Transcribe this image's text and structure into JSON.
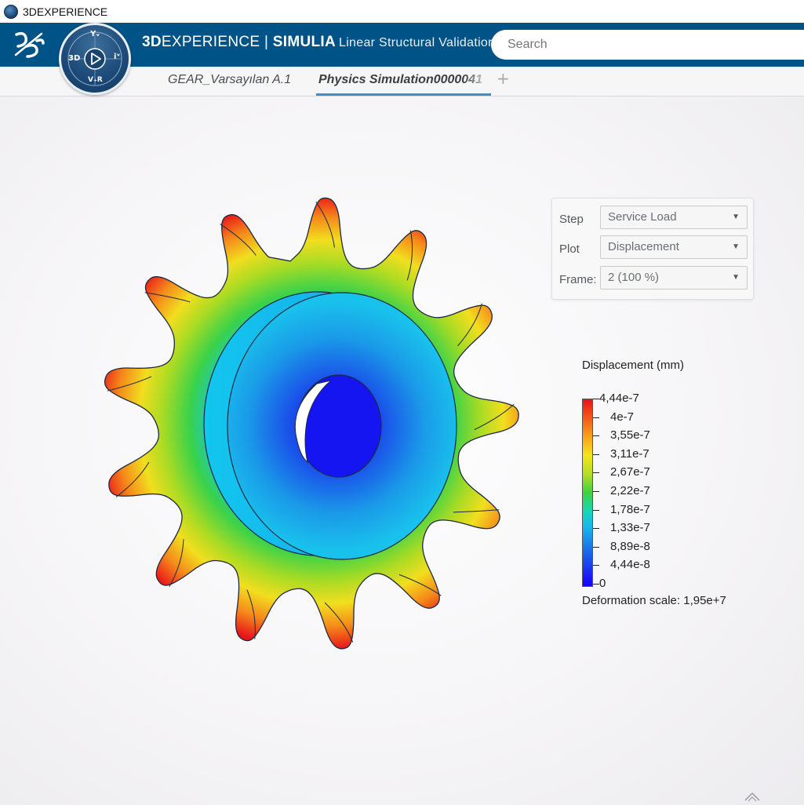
{
  "window": {
    "title": "3DEXPERIENCE"
  },
  "header": {
    "brand_bold": "3D",
    "brand_rest": "EXPERIENCE",
    "separator": " | ",
    "product": "SIMULIA",
    "app_name": "Linear Structural Validation",
    "compass": {
      "top": "Yᵥ",
      "left": "3D",
      "right": "iᵛ",
      "bottom": "V₊R"
    }
  },
  "search": {
    "placeholder": "Search"
  },
  "tabs": [
    {
      "label": "GEAR_Varsayılan A.1",
      "active": false
    },
    {
      "label": "Physics Simulation0000041",
      "active": true
    }
  ],
  "add_tab": "+",
  "panel": {
    "step": {
      "label": "Step",
      "value": "Service Load"
    },
    "plot": {
      "label": "Plot",
      "value": "Displacement"
    },
    "frame": {
      "label": "Frame:",
      "value": "2 (100 %)"
    }
  },
  "legend": {
    "title": "Displacement (mm)",
    "values": [
      "4,44e-7",
      "4e-7",
      "3,55e-7",
      "3,11e-7",
      "2,67e-7",
      "2,22e-7",
      "1,78e-7",
      "1,33e-7",
      "8,89e-8",
      "4,44e-8",
      "0"
    ],
    "deformation": "Deformation scale: 1,95e+7"
  },
  "colors": {
    "header_bg": "#005386",
    "tab_active_underline": "#3e8fd0",
    "max_color": "#e8141a",
    "min_color": "#1400ff"
  }
}
